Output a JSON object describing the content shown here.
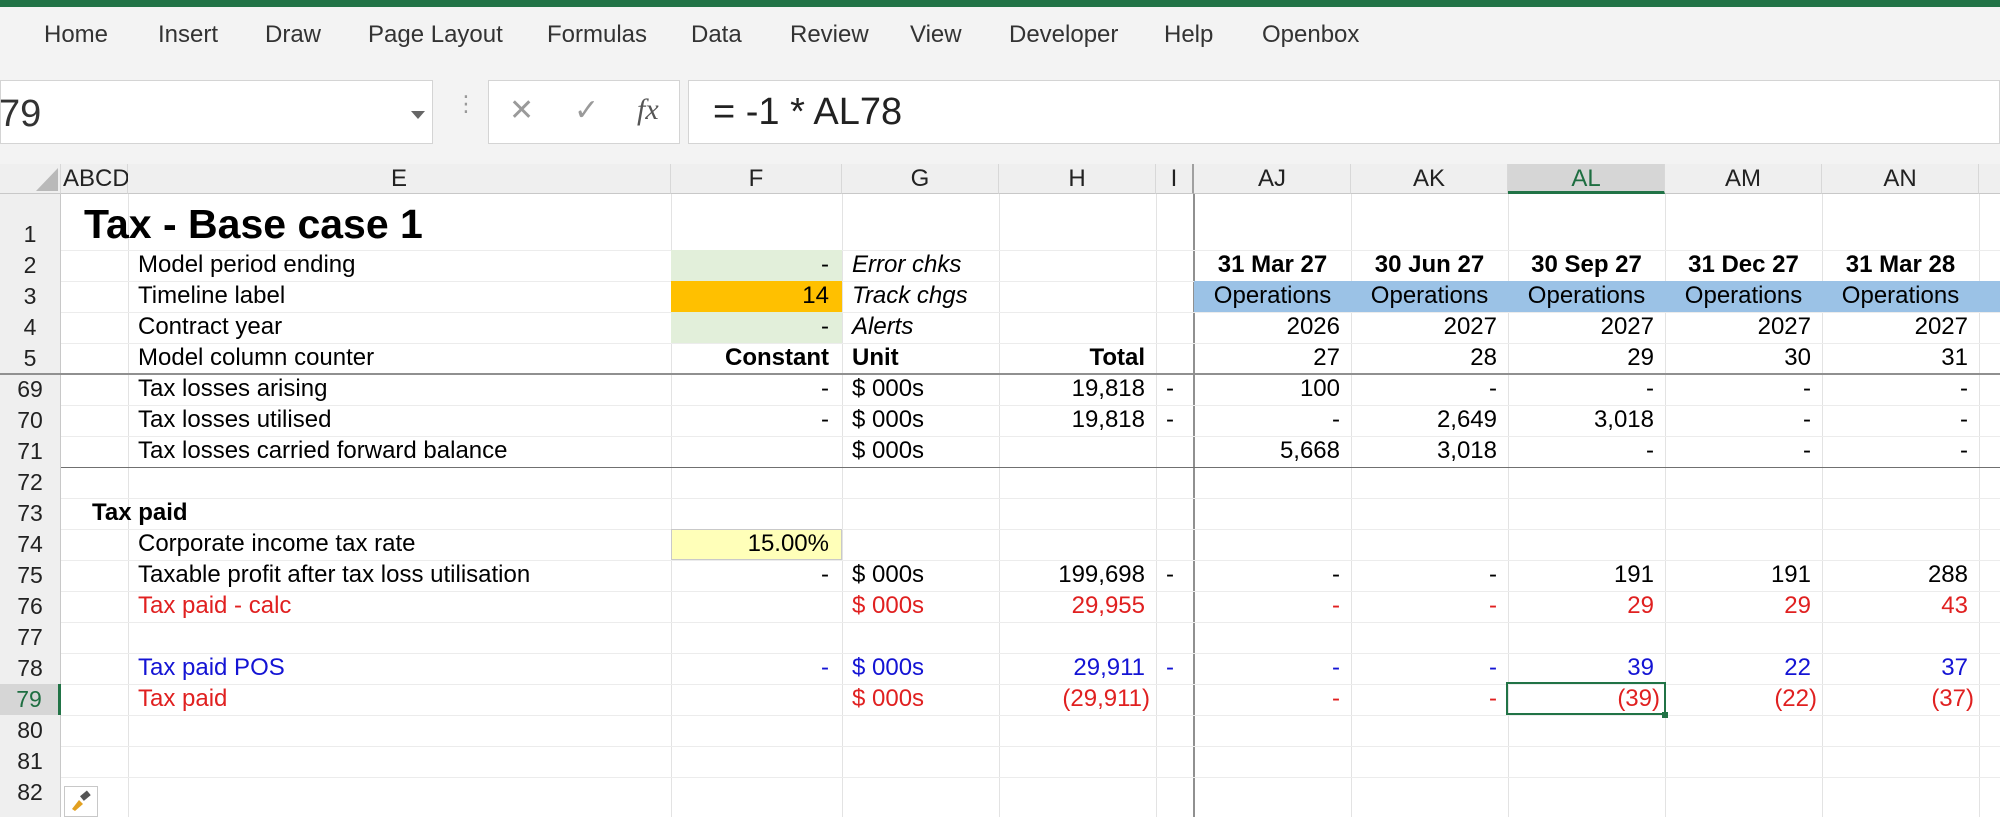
{
  "ribbon": {
    "tabs": [
      "Home",
      "Insert",
      "Draw",
      "Page Layout",
      "Formulas",
      "Data",
      "Review",
      "View",
      "Developer",
      "Help",
      "Openbox"
    ]
  },
  "formula_bar": {
    "name_box": "79",
    "formula": "= -1 * AL78",
    "fx_label": "fx"
  },
  "columns": {
    "corner": "ABCD",
    "E": "E",
    "F": "F",
    "G": "G",
    "H": "H",
    "I": "I",
    "AJ": "AJ",
    "AK": "AK",
    "AL": "AL",
    "AM": "AM",
    "AN": "AN"
  },
  "rows": {
    "r1": {
      "num": "1",
      "E": "Tax - Base case 1"
    },
    "r2": {
      "num": "2",
      "E": "Model period ending",
      "F": "-",
      "G": "Error chks",
      "AJ": "31 Mar 27",
      "AK": "30 Jun 27",
      "AL": "30 Sep 27",
      "AM": "31 Dec 27",
      "AN": "31 Mar 28"
    },
    "r3": {
      "num": "3",
      "E": "Timeline label",
      "F": "14",
      "G": "Track chgs",
      "AJ": "Operations",
      "AK": "Operations",
      "AL": "Operations",
      "AM": "Operations",
      "AN": "Operations"
    },
    "r4": {
      "num": "4",
      "E": "Contract year",
      "F": "-",
      "G": "Alerts",
      "AJ": "2026",
      "AK": "2027",
      "AL": "2027",
      "AM": "2027",
      "AN": "2027"
    },
    "r5": {
      "num": "5",
      "E": "Model column counter",
      "F": "Constant",
      "G": "Unit",
      "H": "Total",
      "AJ": "27",
      "AK": "28",
      "AL": "29",
      "AM": "30",
      "AN": "31"
    },
    "r69": {
      "num": "69",
      "E": "Tax losses arising",
      "F": "-",
      "G": "$ 000s",
      "H": "19,818",
      "I": "-",
      "AJ": "100",
      "AK": "-",
      "AL": "-",
      "AM": "-",
      "AN": "-"
    },
    "r70": {
      "num": "70",
      "E": "Tax losses utilised",
      "F": "-",
      "G": "$ 000s",
      "H": "19,818",
      "I": "-",
      "AJ": "-",
      "AK": "2,649",
      "AL": "3,018",
      "AM": "-",
      "AN": "-"
    },
    "r71": {
      "num": "71",
      "E": "Tax losses carried forward balance",
      "G": "$ 000s",
      "AJ": "5,668",
      "AK": "3,018",
      "AL": "-",
      "AM": "-",
      "AN": "-"
    },
    "r72": {
      "num": "72"
    },
    "r73": {
      "num": "73",
      "D": "Tax paid"
    },
    "r74": {
      "num": "74",
      "E": "Corporate income tax rate",
      "F": "15.00%"
    },
    "r75": {
      "num": "75",
      "E": "Taxable profit after tax loss utilisation",
      "F": "-",
      "G": "$ 000s",
      "H": "199,698",
      "I": "-",
      "AJ": "-",
      "AK": "-",
      "AL": "191",
      "AM": "191",
      "AN": "288"
    },
    "r76": {
      "num": "76",
      "E": "Tax paid - calc",
      "G": "$ 000s",
      "H": "29,955",
      "AJ": "-",
      "AK": "-",
      "AL": "29",
      "AM": "29",
      "AN": "43"
    },
    "r77": {
      "num": "77"
    },
    "r78": {
      "num": "78",
      "E": "Tax paid POS",
      "F": "-",
      "G": "$ 000s",
      "H": "29,911",
      "I": "-",
      "AJ": "-",
      "AK": "-",
      "AL": "39",
      "AM": "22",
      "AN": "37"
    },
    "r79": {
      "num": "79",
      "E": "Tax paid",
      "G": "$ 000s",
      "H": "(29,911)",
      "AJ": "-",
      "AK": "-",
      "AL": "(39)",
      "AM": "(22)",
      "AN": "(37)"
    },
    "r80": {
      "num": "80"
    },
    "r81": {
      "num": "81"
    },
    "r82": {
      "num": "82"
    }
  },
  "colors": {
    "excel_green": "#217346",
    "input_green": "#e2efda",
    "timeline_orange": "#ffc000",
    "input_yellow": "#ffffb9",
    "operations_blue": "#9bc2e6",
    "calc_red": "#e02020",
    "link_blue": "#1414d4"
  },
  "icons": {
    "name_box_dropdown": "chevron-down-icon",
    "cancel": "close-icon",
    "enter": "check-icon",
    "function": "fx-icon",
    "select_all": "select-all-triangle-icon",
    "format_painter": "paint-brush-icon"
  }
}
